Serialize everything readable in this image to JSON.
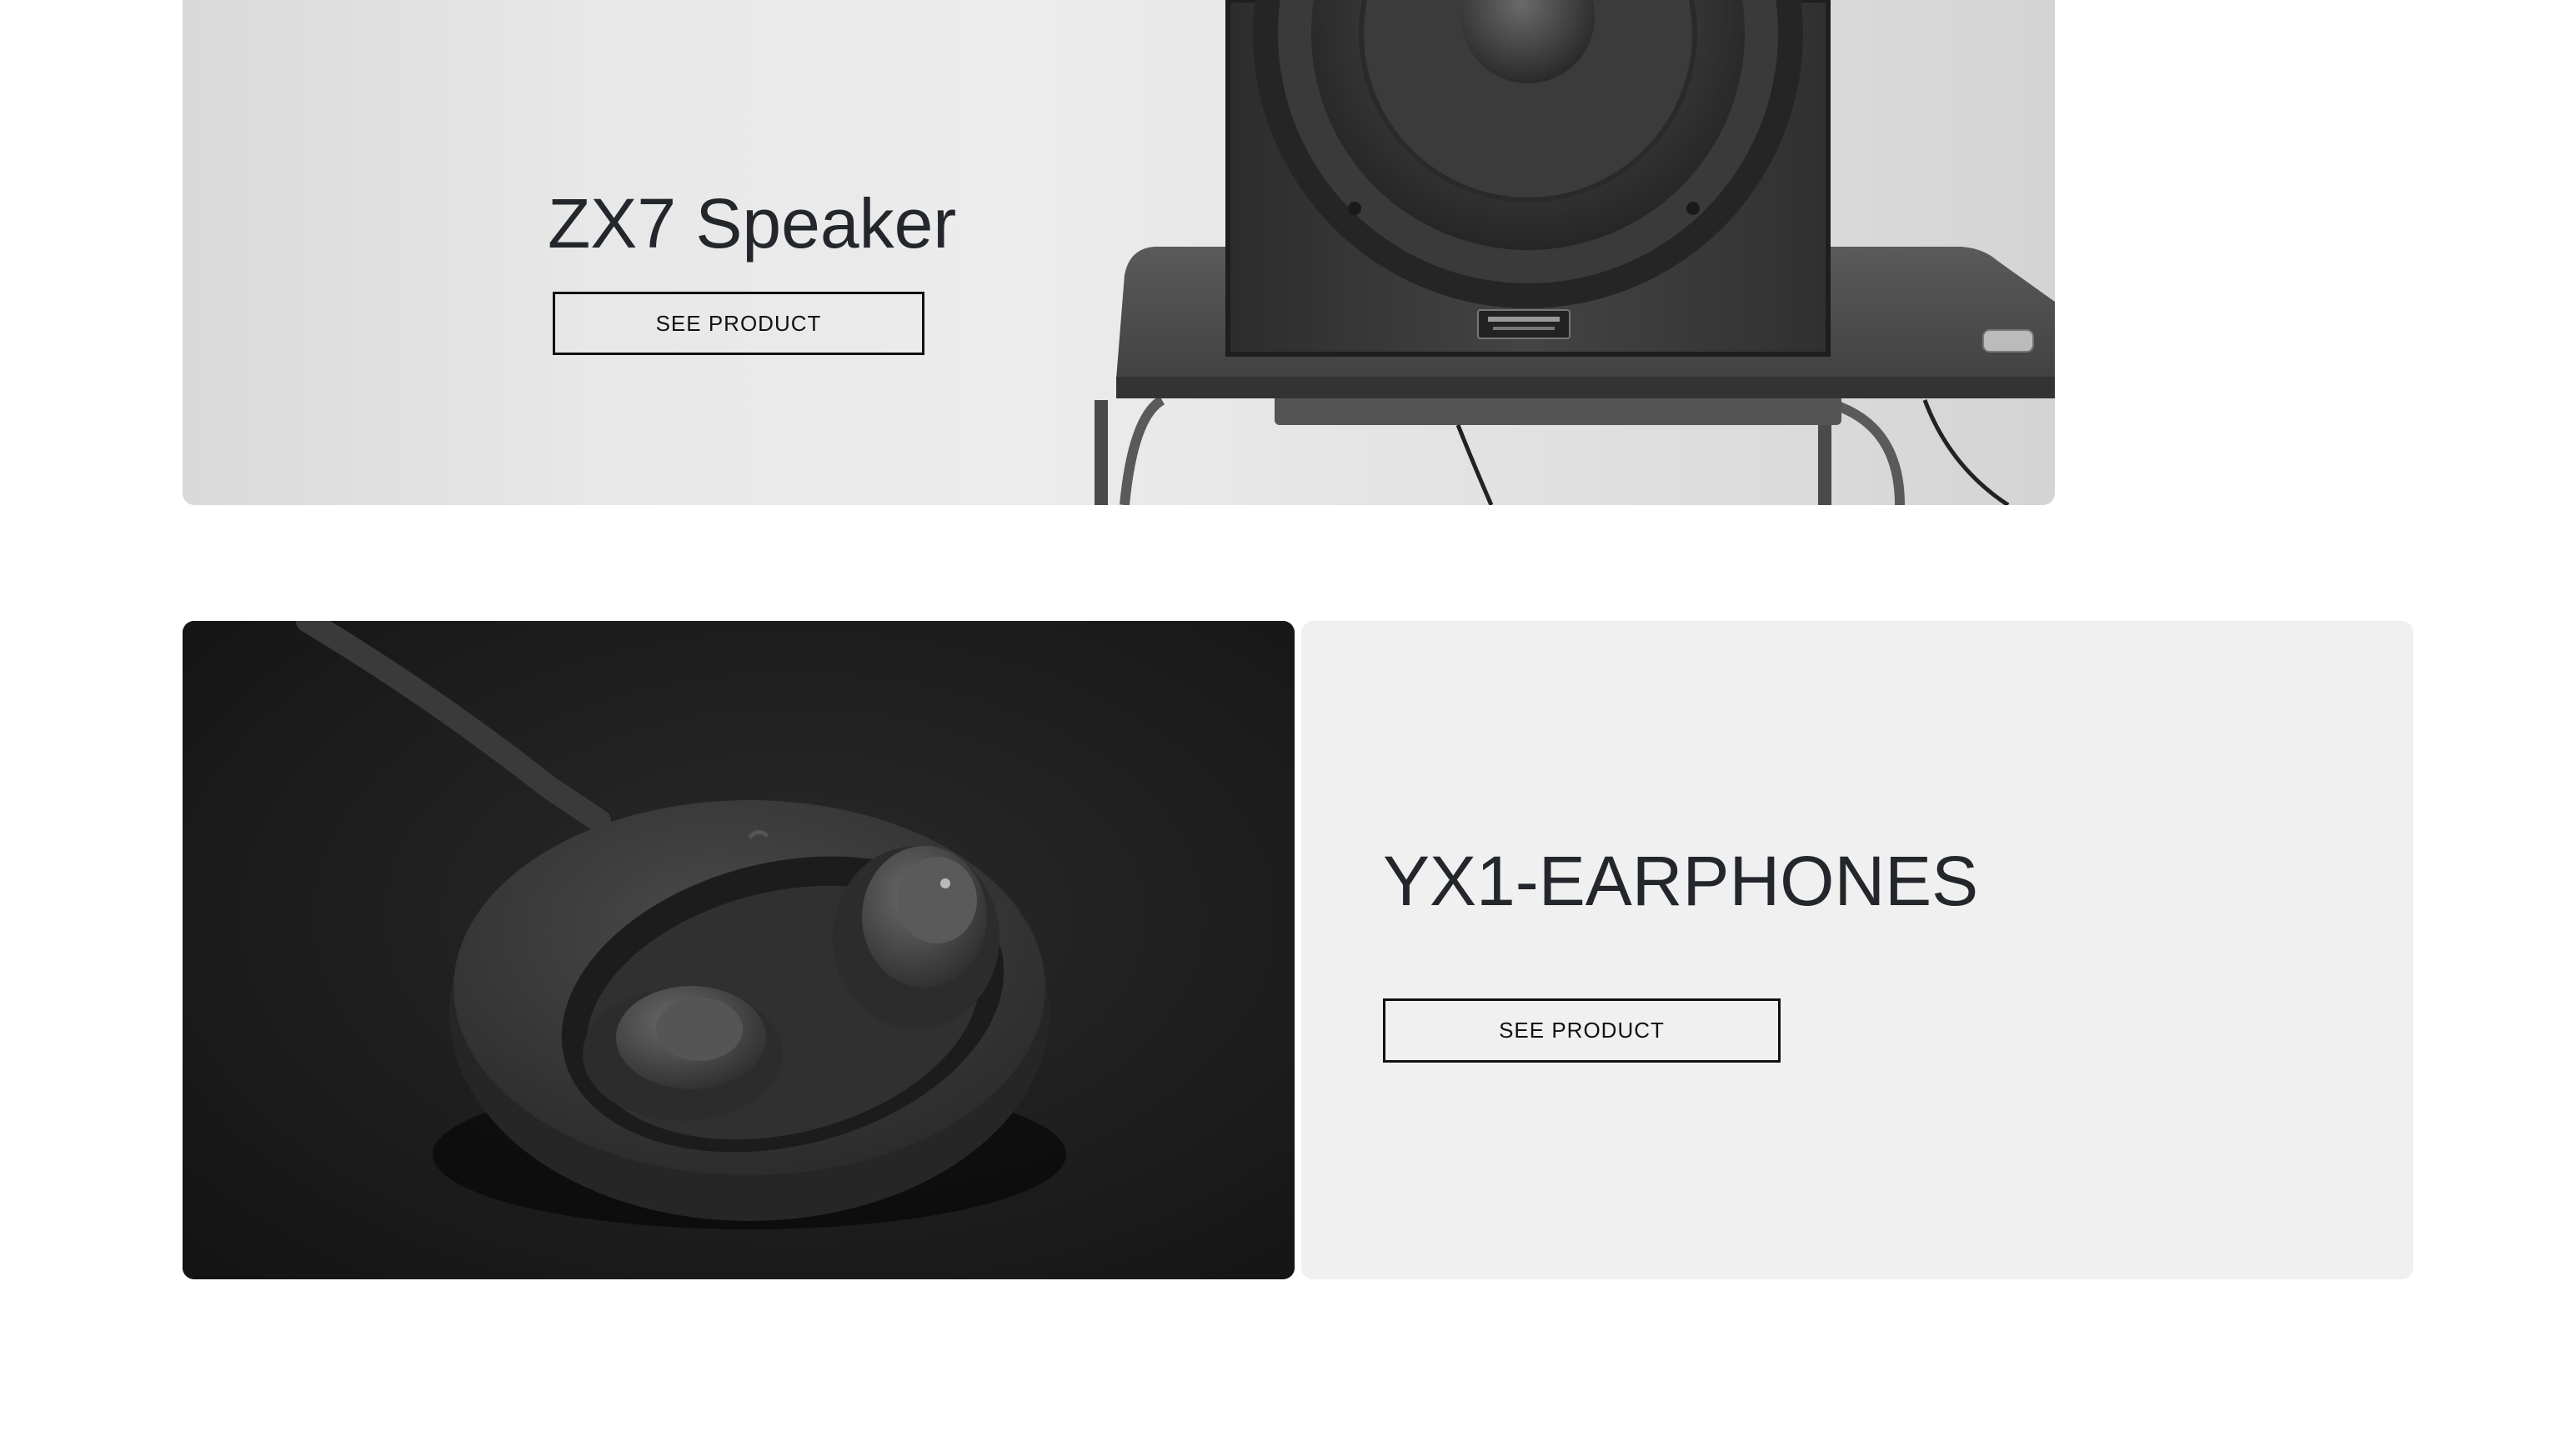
{
  "speaker": {
    "title": "ZX7 Speaker",
    "button_label": "SEE PRODUCT"
  },
  "earphones": {
    "title": "YX1-EARPHONES",
    "button_label": "SEE PRODUCT"
  },
  "colors": {
    "panel_background": "#f0f0f0",
    "text": "#23272b",
    "button_border": "#111111"
  }
}
